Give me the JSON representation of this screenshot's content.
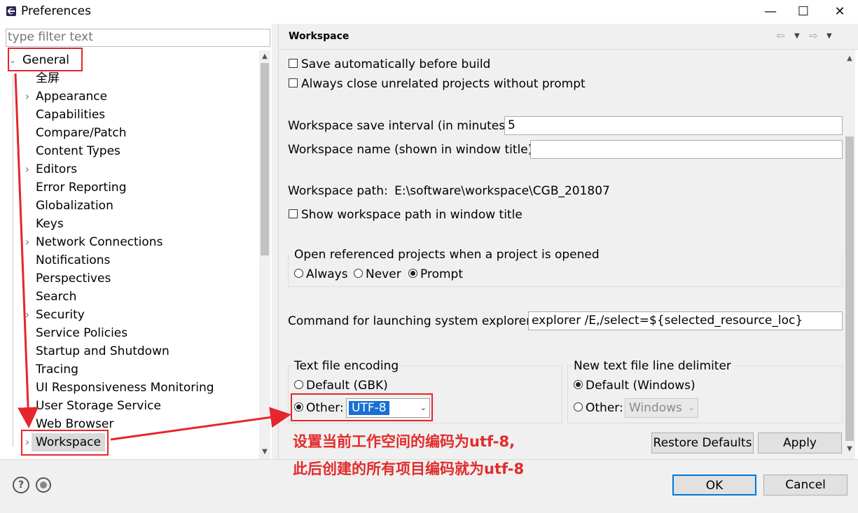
{
  "window": {
    "title": "Preferences",
    "minimize": "—",
    "maximize": "☐",
    "close": "✕"
  },
  "filter": {
    "placeholder": "type filter text"
  },
  "tree": {
    "root": "General",
    "items": [
      {
        "label": "全屏",
        "chevron": false
      },
      {
        "label": "Appearance",
        "chevron": true
      },
      {
        "label": "Capabilities",
        "chevron": false
      },
      {
        "label": "Compare/Patch",
        "chevron": false
      },
      {
        "label": "Content Types",
        "chevron": false
      },
      {
        "label": "Editors",
        "chevron": true
      },
      {
        "label": "Error Reporting",
        "chevron": false
      },
      {
        "label": "Globalization",
        "chevron": false
      },
      {
        "label": "Keys",
        "chevron": false
      },
      {
        "label": "Network Connections",
        "chevron": true
      },
      {
        "label": "Notifications",
        "chevron": false
      },
      {
        "label": "Perspectives",
        "chevron": false
      },
      {
        "label": "Search",
        "chevron": false
      },
      {
        "label": "Security",
        "chevron": true
      },
      {
        "label": "Service Policies",
        "chevron": false
      },
      {
        "label": "Startup and Shutdown",
        "chevron": false
      },
      {
        "label": "Tracing",
        "chevron": false
      },
      {
        "label": "UI Responsiveness Monitoring",
        "chevron": false
      },
      {
        "label": "User Storage Service",
        "chevron": false
      },
      {
        "label": "Web Browser",
        "chevron": false
      },
      {
        "label": "Workspace",
        "chevron": true,
        "selected": true
      }
    ]
  },
  "page": {
    "title": "Workspace",
    "save_before_build": "Save automatically before build",
    "close_unrelated": "Always close unrelated projects without prompt",
    "save_interval_label": "Workspace save interval (in minutes):",
    "save_interval_value": "5",
    "workspace_name_label": "Workspace name (shown in window title):",
    "workspace_name_value": "",
    "workspace_path_label": "Workspace path:",
    "workspace_path_value": "E:\\software\\workspace\\CGB_201807",
    "show_path_label": "Show workspace path in window title",
    "open_ref_group": "Open referenced projects when a project is opened",
    "open_ref_options": [
      "Always",
      "Never",
      "Prompt"
    ],
    "open_ref_selected": "Prompt",
    "explorer_label": "Command for launching system explorer:",
    "explorer_value": "explorer /E,/select=${selected_resource_loc}",
    "encoding_group": "Text file encoding",
    "encoding_default": "Default (GBK)",
    "encoding_other": "Other:",
    "encoding_value": "UTF-8",
    "delimiter_group": "New text file line delimiter",
    "delimiter_default": "Default (Windows)",
    "delimiter_other": "Other:",
    "delimiter_value": "Windows",
    "restore_defaults": "Restore Defaults",
    "apply": "Apply"
  },
  "annotation": {
    "line1": "设置当前工作空间的编码为utf-8,",
    "line2": "此后创建的所有项目编码就为utf-8",
    "color": "#e22b2b"
  },
  "footer": {
    "ok": "OK",
    "cancel": "Cancel",
    "help": "?"
  }
}
